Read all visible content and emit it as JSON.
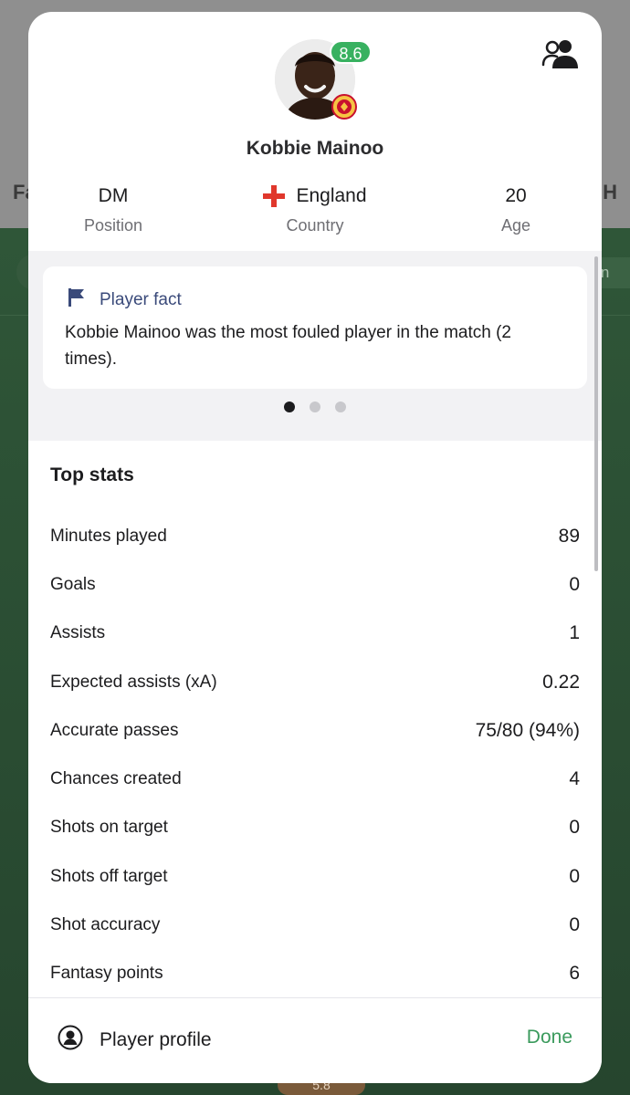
{
  "background": {
    "left_fragment": "Fa",
    "right_fragment": "H",
    "chip_fragment": "Fan",
    "bottom_badge": "5.8"
  },
  "player": {
    "name": "Kobbie Mainoo",
    "rating": "8.6",
    "position": "DM",
    "position_label": "Position",
    "country": "England",
    "country_label": "Country",
    "age": "20",
    "age_label": "Age"
  },
  "fact": {
    "title": "Player fact",
    "text": "Kobbie Mainoo was the most fouled player in the match (2 times).",
    "page_count": 3,
    "active_page": 0
  },
  "top_stats": {
    "title": "Top stats",
    "rows": [
      {
        "label": "Minutes played",
        "value": "89"
      },
      {
        "label": "Goals",
        "value": "0"
      },
      {
        "label": "Assists",
        "value": "1"
      },
      {
        "label": "Expected assists (xA)",
        "value": "0.22"
      },
      {
        "label": "Accurate passes",
        "value": "75/80 (94%)"
      },
      {
        "label": "Chances created",
        "value": "4"
      },
      {
        "label": "Shots on target",
        "value": "0"
      },
      {
        "label": "Shots off target",
        "value": "0"
      },
      {
        "label": "Shot accuracy",
        "value": "0"
      },
      {
        "label": "Fantasy points",
        "value": "6"
      }
    ]
  },
  "footer": {
    "profile_label": "Player profile",
    "done_label": "Done"
  },
  "colors": {
    "rating_green": "#38b160",
    "done_green": "#3a9a5c",
    "fact_title_blue": "#3a4a7a",
    "flag_red": "#e0372c"
  }
}
